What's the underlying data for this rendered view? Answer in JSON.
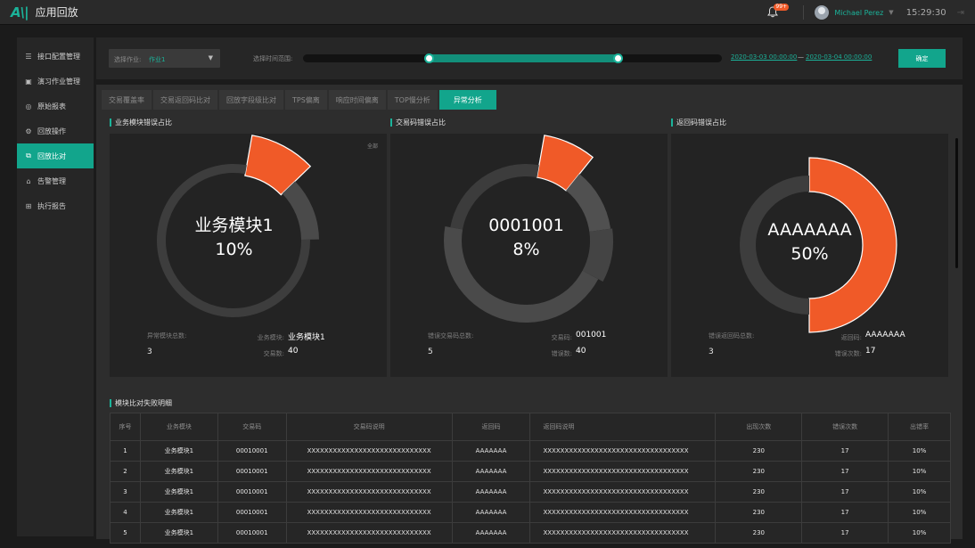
{
  "app": {
    "logo": "A\\|",
    "title": "应用回放"
  },
  "topbar": {
    "badge": "99+",
    "username": "Michael Perez",
    "time": "15:29:30",
    "caret": "▼",
    "logout": "⇥"
  },
  "sidebar": {
    "items": [
      {
        "label": "接口配置管理",
        "icon": "sliders-icon",
        "glyph": "☰",
        "active": false
      },
      {
        "label": "演习作业管理",
        "icon": "task-icon",
        "glyph": "▣",
        "active": false
      },
      {
        "label": "原始报表",
        "icon": "report-icon",
        "glyph": "◎",
        "active": false
      },
      {
        "label": "回放操作",
        "icon": "gear-icon",
        "glyph": "⚙",
        "active": false
      },
      {
        "label": "回放比对",
        "icon": "compare-icon",
        "glyph": "⧉",
        "active": true
      },
      {
        "label": "告警管理",
        "icon": "alarm-icon",
        "glyph": "⌂",
        "active": false
      },
      {
        "label": "执行报告",
        "icon": "doc-icon",
        "glyph": "⊞",
        "active": false
      }
    ]
  },
  "filter": {
    "job_label": "选择作业:",
    "job_value": "作业1",
    "range_label": "选择时间范围:",
    "range_start": 0.3,
    "range_end": 0.75,
    "start_date": "2020-03-03 00:00:00",
    "date_sep": "—",
    "end_date": "2020-03-04 00:00:00",
    "confirm": "确定"
  },
  "tabs": [
    "交易覆盖率",
    "交易返回码比对",
    "回放字段级比对",
    "TPS偏离",
    "响应时间偏离",
    "TOP慢分析",
    "异常分析"
  ],
  "active_tab": 6,
  "panels": [
    {
      "title": "业务模块错误占比",
      "corner": "全部",
      "center_name": "业务模块1",
      "center_pct": "10%",
      "stat1_label": "异常模块总数:",
      "stat1_value": "3",
      "stat2_label": "业务模块:",
      "stat2_value": "业务模块1",
      "stat3_label": "交易数:",
      "stat3_value": "40"
    },
    {
      "title": "交易码错误占比",
      "corner": "",
      "center_name": "0001001",
      "center_pct": "8%",
      "stat1_label": "错误交易码总数:",
      "stat1_value": "5",
      "stat2_label": "交易码:",
      "stat2_value": "001001",
      "stat3_label": "错误数:",
      "stat3_value": "40"
    },
    {
      "title": "返回码错误占比",
      "corner": "",
      "center_name": "AAAAAAA",
      "center_pct": "50%",
      "stat1_label": "错误返回码总数:",
      "stat1_value": "3",
      "stat2_label": "返回码:",
      "stat2_value": "AAAAAAA",
      "stat3_label": "错误次数:",
      "stat3_value": "17"
    }
  ],
  "chart_data": [
    {
      "type": "pie",
      "title": "业务模块错误占比",
      "slices": [
        {
          "name": "业务模块1",
          "value": 10,
          "highlight": true
        },
        {
          "value": 12
        },
        {
          "value": 78
        }
      ]
    },
    {
      "type": "pie",
      "title": "交易码错误占比",
      "slices": [
        {
          "name": "0001001",
          "value": 8,
          "highlight": true
        },
        {
          "value": 12
        },
        {
          "value": 10
        },
        {
          "value": 45
        },
        {
          "value": 25
        }
      ]
    },
    {
      "type": "pie",
      "title": "返回码错误占比",
      "slices": [
        {
          "name": "AAAAAAA",
          "value": 50,
          "highlight": true
        },
        {
          "value": 50
        }
      ]
    }
  ],
  "colors": {
    "accent": "#12a58c",
    "highlight": "#f05a28",
    "ring_dark": "#3d3d3d",
    "ring_mid": "#4d4d4d",
    "ring_light": "#555555"
  },
  "table": {
    "title": "模块比对失败明细",
    "headers": [
      "序号",
      "业务模块",
      "交易码",
      "交易码说明",
      "返回码",
      "返回码说明",
      "出现次数",
      "错误次数",
      "出错率"
    ],
    "rows": [
      [
        "1",
        "业务模块1",
        "00010001",
        "XXXXXXXXXXXXXXXXXXXXXXXXXXXXX",
        "AAAAAAA",
        "XXXXXXXXXXXXXXXXXXXXXXXXXXXXXXXXXX",
        "230",
        "17",
        "10%"
      ],
      [
        "2",
        "业务模块1",
        "00010001",
        "XXXXXXXXXXXXXXXXXXXXXXXXXXXXX",
        "AAAAAAA",
        "XXXXXXXXXXXXXXXXXXXXXXXXXXXXXXXXXX",
        "230",
        "17",
        "10%"
      ],
      [
        "3",
        "业务模块1",
        "00010001",
        "XXXXXXXXXXXXXXXXXXXXXXXXXXXXX",
        "AAAAAAA",
        "XXXXXXXXXXXXXXXXXXXXXXXXXXXXXXXXXX",
        "230",
        "17",
        "10%"
      ],
      [
        "4",
        "业务模块1",
        "00010001",
        "XXXXXXXXXXXXXXXXXXXXXXXXXXXXX",
        "AAAAAAA",
        "XXXXXXXXXXXXXXXXXXXXXXXXXXXXXXXXXX",
        "230",
        "17",
        "10%"
      ],
      [
        "5",
        "业务模块1",
        "00010001",
        "XXXXXXXXXXXXXXXXXXXXXXXXXXXXX",
        "AAAAAAA",
        "XXXXXXXXXXXXXXXXXXXXXXXXXXXXXXXXXX",
        "230",
        "17",
        "10%"
      ]
    ]
  }
}
